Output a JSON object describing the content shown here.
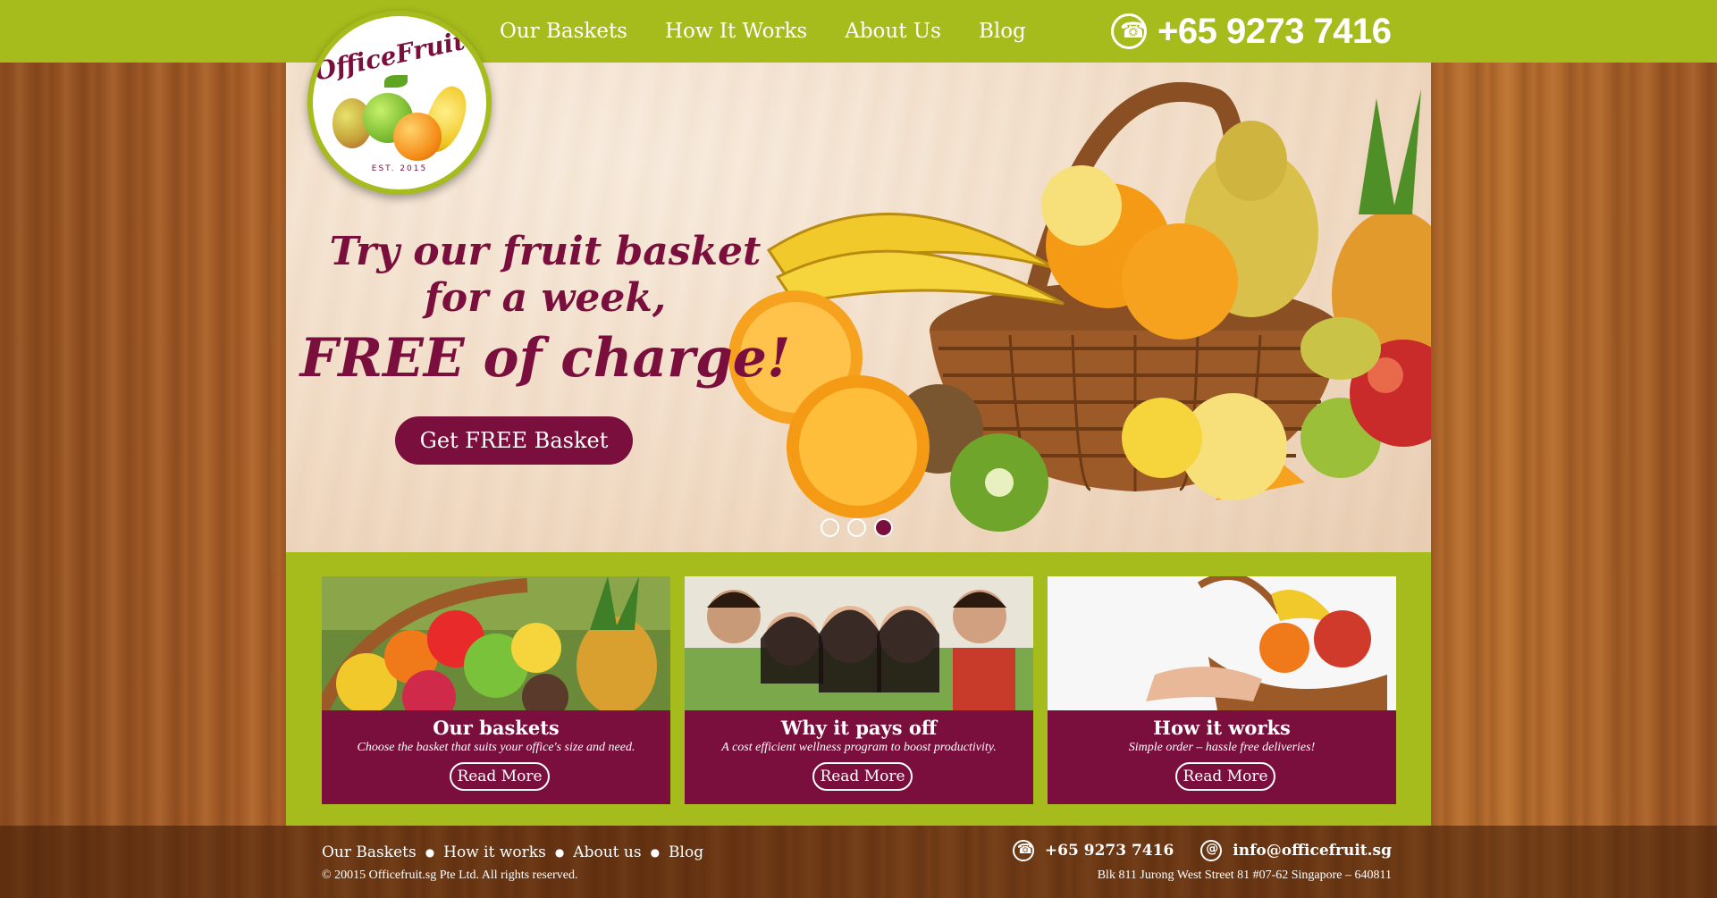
{
  "brand": {
    "logo_text": "OfficeFruit.sg",
    "logo_est": "EST. 2015"
  },
  "nav": {
    "items": [
      {
        "label": "Our Baskets"
      },
      {
        "label": "How It Works"
      },
      {
        "label": "About Us"
      },
      {
        "label": "Blog"
      }
    ],
    "phone": "+65 9273 7416"
  },
  "hero": {
    "line1": "Try our fruit basket",
    "line2": "for a week,",
    "line3": "FREE of charge!",
    "cta": "Get FREE Basket",
    "slides_count": 3,
    "active_slide": 3
  },
  "features": [
    {
      "title": "Our baskets",
      "subtitle": "Choose the basket that suits your office's size and need.",
      "button": "Read More"
    },
    {
      "title": "Why it pays off",
      "subtitle": "A cost efficient wellness program to boost productivity.",
      "button": "Read More"
    },
    {
      "title": "How it works",
      "subtitle": "Simple order – hassle free deliveries!",
      "button": "Read More"
    }
  ],
  "footer": {
    "links": [
      {
        "label": "Our Baskets"
      },
      {
        "label": "How it works"
      },
      {
        "label": "About us"
      },
      {
        "label": "Blog"
      }
    ],
    "copyright": "© 20015 Officefruit.sg Pte Ltd. All rights reserved.",
    "phone": "+65 9273 7416",
    "email": "info@officefruit.sg",
    "address": "Blk 811 Jurong West Street 81 #07-62 Singapore – 640811"
  },
  "colors": {
    "green": "#a6bb1c",
    "maroon": "#7a0f3d",
    "wood": "#a85e27"
  },
  "icons": {
    "phone": "phone-icon",
    "email": "email-icon"
  }
}
